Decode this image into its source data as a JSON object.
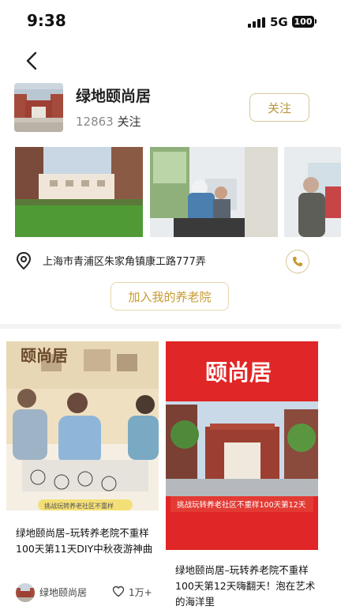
{
  "status": {
    "time": "9:38",
    "network": "5G",
    "battery": "100"
  },
  "profile": {
    "name": "绿地颐尚居",
    "followers": "12863",
    "followers_label": "关注",
    "follow_button": "关注"
  },
  "location": {
    "address": "上海市青浦区朱家角镇康工路777弄"
  },
  "join_button": "加入我的养老院",
  "posts": [
    {
      "title": "绿地颐尚居–玩转养老院不重样100天第11天DIY中秋夜游神曲",
      "cover_banner": "颐尚居",
      "cover_caption": "挑战玩转养老社区不重样",
      "author": "绿地颐尚居",
      "likes": "1万+"
    },
    {
      "title": "绿地颐尚居–玩转养老院不重样100天第12天嗨翻天！泡在艺术的海洋里",
      "cover_banner": "颐尚居",
      "cover_caption": "挑战玩转养老社区不重样100天第12天"
    }
  ],
  "icons": {
    "back": "chevron-left-icon",
    "location": "location-pin-icon",
    "phone": "phone-icon",
    "like": "heart-icon"
  },
  "colors": {
    "accent": "#c79a2e",
    "accent_border": "#d8c79a",
    "red_cover": "#e02626"
  }
}
